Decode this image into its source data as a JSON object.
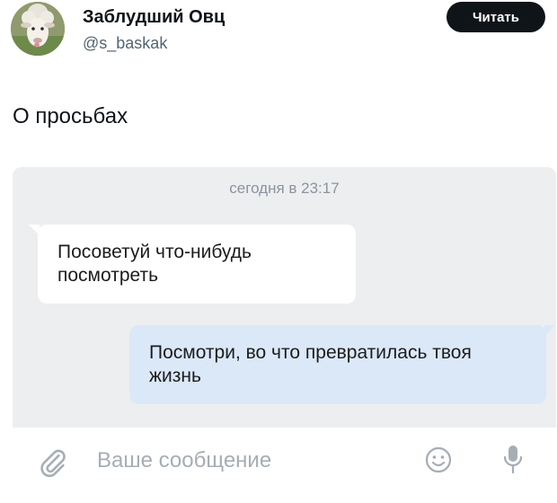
{
  "author": {
    "name": "Заблудший Овц",
    "handle": "@s_baskak",
    "follow_label": "Читать",
    "avatar_icon": "sheep-avatar"
  },
  "tweet": {
    "text": "О просьбах"
  },
  "chat": {
    "timestamp": "сегодня в 23:17",
    "messages": [
      {
        "direction": "incoming",
        "text": "Посоветуй что-нибудь посмотреть"
      },
      {
        "direction": "outgoing",
        "text": "Посмотри, во что превратилась твоя жизнь"
      }
    ],
    "composer": {
      "placeholder": "Ваше сообщение",
      "icons": [
        "attachment-icon",
        "emoji-icon",
        "microphone-icon"
      ]
    }
  },
  "colors": {
    "chat_background": "#edeef0",
    "incoming_bubble": "#ffffff",
    "outgoing_bubble": "#dbe8f8",
    "follow_button": "#0f1419",
    "icon_gray": "#a6adb5"
  }
}
